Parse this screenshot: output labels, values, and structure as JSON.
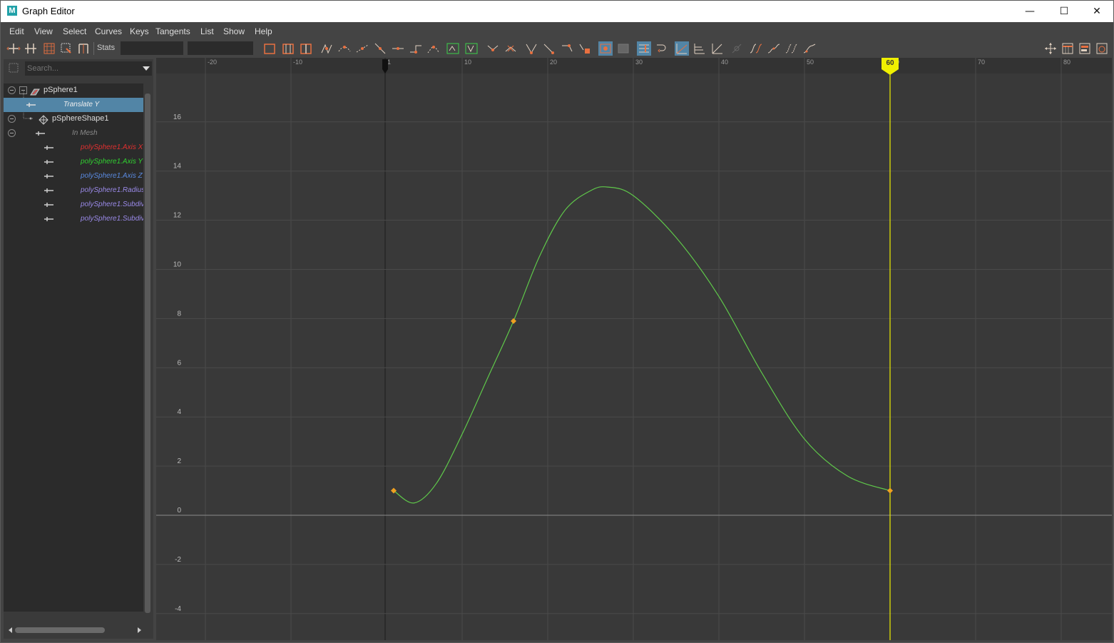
{
  "window": {
    "title": "Graph Editor",
    "app_icon": "M",
    "controls": {
      "minimize": "—",
      "maximize": "☐",
      "close": "✕"
    }
  },
  "menu": [
    "Edit",
    "View",
    "Select",
    "Curves",
    "Keys",
    "Tangents",
    "List",
    "Show",
    "Help"
  ],
  "toolbar": {
    "stats_label": "Stats",
    "stats_field1": "",
    "stats_field2": ""
  },
  "outliner": {
    "search_placeholder": "Search...",
    "items": [
      {
        "label": "pSphere1",
        "color": "#dddddd",
        "italic": false,
        "selected": false,
        "icon": "transform-icon"
      },
      {
        "label": "Translate Y",
        "color": "#eeeeee",
        "italic": true,
        "selected": true,
        "icon": "attribute-icon"
      },
      {
        "label": "pSphereShape1",
        "color": "#dddddd",
        "italic": false,
        "selected": false,
        "icon": "shape-icon"
      },
      {
        "label": "In Mesh",
        "color": "#8a8a8a",
        "italic": true,
        "selected": false,
        "icon": "attribute-icon"
      },
      {
        "label": "polySphere1.Axis X",
        "color": "#e03030",
        "italic": true,
        "selected": false,
        "icon": "attribute-icon"
      },
      {
        "label": "polySphere1.Axis Y",
        "color": "#30d030",
        "italic": true,
        "selected": false,
        "icon": "attribute-icon"
      },
      {
        "label": "polySphere1.Axis Z",
        "color": "#5a8ae0",
        "italic": true,
        "selected": false,
        "icon": "attribute-icon"
      },
      {
        "label": "polySphere1.Radius",
        "color": "#9a8ae8",
        "italic": true,
        "selected": false,
        "icon": "attribute-icon"
      },
      {
        "label": "polySphere1.Subdivi",
        "color": "#9a8ae8",
        "italic": true,
        "selected": false,
        "icon": "attribute-icon"
      },
      {
        "label": "polySphere1.Subdivi",
        "color": "#9a8ae8",
        "italic": true,
        "selected": false,
        "icon": "attribute-icon"
      }
    ]
  },
  "graph": {
    "x_ticks": [
      -20,
      -10,
      1,
      10,
      20,
      30,
      40,
      50,
      60,
      70,
      80
    ],
    "y_ticks": [
      16,
      14,
      12,
      10,
      8,
      6,
      4,
      2,
      0,
      -2,
      -4
    ],
    "current_frame": "60",
    "curve_color": "#5fc84a",
    "key_color": "#f0a020",
    "time_marker_color": "#f0f000",
    "keys": [
      {
        "frame": 2,
        "value": 1.0
      },
      {
        "frame": 16,
        "value": 7.9
      },
      {
        "frame": 60,
        "value": 1.0
      }
    ],
    "curve_samples": [
      {
        "frame": 2,
        "value": 1.0
      },
      {
        "frame": 4.4,
        "value": 0.5
      },
      {
        "frame": 7,
        "value": 1.3
      },
      {
        "frame": 10,
        "value": 3.3
      },
      {
        "frame": 13,
        "value": 5.6
      },
      {
        "frame": 16,
        "value": 7.9
      },
      {
        "frame": 19,
        "value": 10.5
      },
      {
        "frame": 22,
        "value": 12.4
      },
      {
        "frame": 25,
        "value": 13.2
      },
      {
        "frame": 27,
        "value": 13.35
      },
      {
        "frame": 30,
        "value": 13.0
      },
      {
        "frame": 35,
        "value": 11.3
      },
      {
        "frame": 40,
        "value": 8.9
      },
      {
        "frame": 45,
        "value": 5.8
      },
      {
        "frame": 50,
        "value": 3.1
      },
      {
        "frame": 55,
        "value": 1.6
      },
      {
        "frame": 60,
        "value": 1.0
      }
    ]
  }
}
